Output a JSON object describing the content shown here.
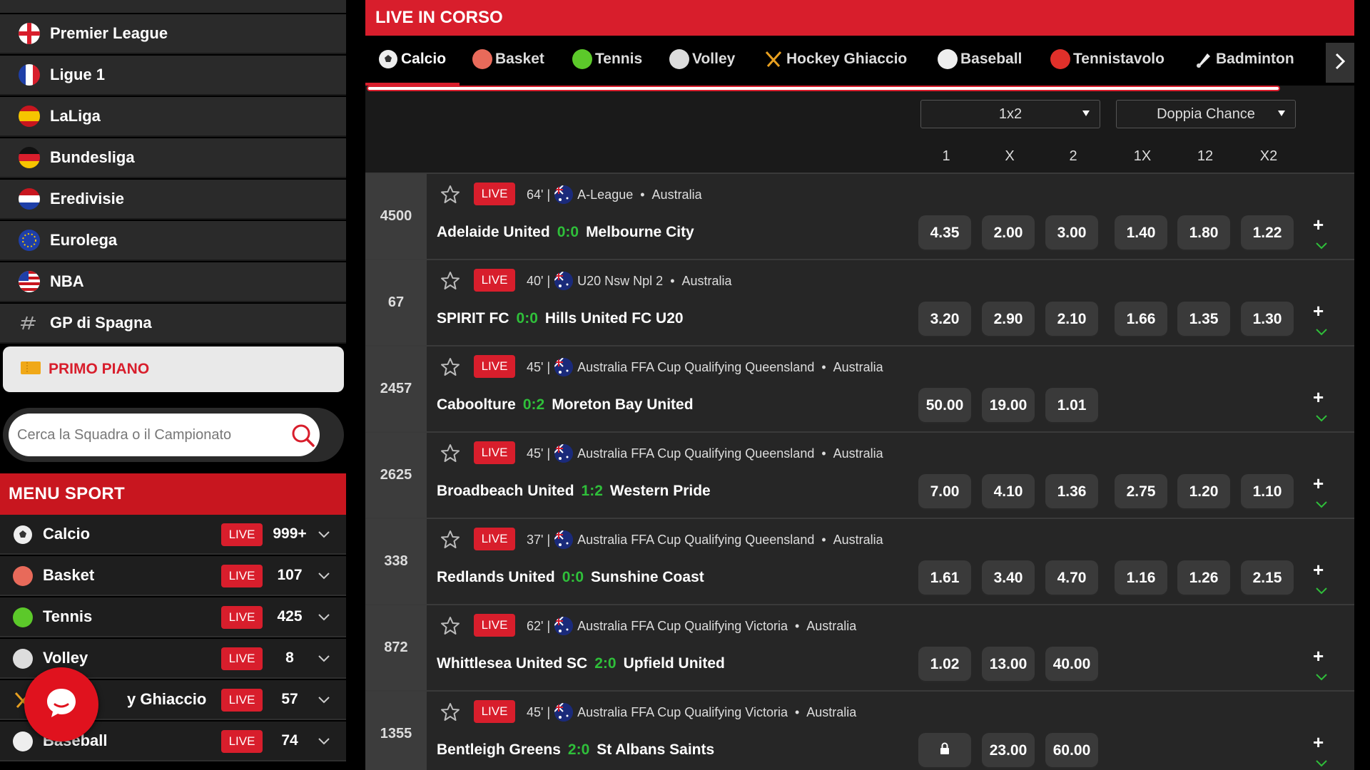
{
  "sidebar": {
    "leagues": [
      {
        "label": "Premier League",
        "flag": "england"
      },
      {
        "label": "Ligue 1",
        "flag": "france"
      },
      {
        "label": "LaLiga",
        "flag": "spain"
      },
      {
        "label": "Bundesliga",
        "flag": "germany"
      },
      {
        "label": "Eredivisie",
        "flag": "netherlands"
      },
      {
        "label": "Eurolega",
        "flag": "eu"
      },
      {
        "label": "NBA",
        "flag": "usa"
      },
      {
        "label": "GP di Spagna",
        "flag": "f1"
      }
    ],
    "primo_piano": "PRIMO PIANO",
    "search_placeholder": "Cerca la Squadra o il Campionato",
    "menu_title": "MENU SPORT",
    "live_label": "LIVE",
    "sports": [
      {
        "label": "Calcio",
        "count": "999+",
        "icon": "soccer-ball-icon"
      },
      {
        "label": "Basket",
        "count": "107",
        "icon": "basketball-icon"
      },
      {
        "label": "Tennis",
        "count": "425",
        "icon": "tennis-ball-icon"
      },
      {
        "label": "Volley",
        "count": "8",
        "icon": "volleyball-icon"
      },
      {
        "label": "y Ghiaccio",
        "count": "57",
        "icon": "hockey-icon"
      },
      {
        "label": "Baseball",
        "count": "74",
        "icon": "baseball-icon"
      }
    ]
  },
  "main": {
    "title": "LIVE IN CORSO",
    "tabs": [
      {
        "label": "Calcio",
        "icon": "soccer-ball-icon"
      },
      {
        "label": "Basket",
        "icon": "basketball-icon"
      },
      {
        "label": "Tennis",
        "icon": "tennis-ball-icon"
      },
      {
        "label": "Volley",
        "icon": "volleyball-icon"
      },
      {
        "label": "Hockey Ghiaccio",
        "icon": "hockey-icon"
      },
      {
        "label": "Baseball",
        "icon": "baseball-icon"
      },
      {
        "label": "Tennistavolo",
        "icon": "table-tennis-icon"
      },
      {
        "label": "Badminton",
        "icon": "badminton-icon"
      }
    ],
    "select_1": "1x2",
    "select_2": "Doppia Chance",
    "columns": [
      "1",
      "X",
      "2",
      "1X",
      "12",
      "X2"
    ],
    "live_label": "LIVE",
    "matches": [
      {
        "id": "4500",
        "minute": "64'",
        "competition": "A-League",
        "country": "Australia",
        "home": "Adelaide United",
        "score": "0:0",
        "away": "Melbourne City",
        "odds": [
          "4.35",
          "2.00",
          "3.00",
          "1.40",
          "1.80",
          "1.22"
        ]
      },
      {
        "id": "67",
        "minute": "40'",
        "competition": "U20 Nsw Npl 2",
        "country": "Australia",
        "home": "SPIRIT FC",
        "score": "0:0",
        "away": "Hills United FC U20",
        "odds": [
          "3.20",
          "2.90",
          "2.10",
          "1.66",
          "1.35",
          "1.30"
        ]
      },
      {
        "id": "2457",
        "minute": "45'",
        "competition": "Australia FFA Cup Qualifying Queensland",
        "country": "Australia",
        "home": "Caboolture",
        "score": "0:2",
        "away": "Moreton Bay United",
        "odds": [
          "50.00",
          "19.00",
          "1.01",
          "",
          "",
          ""
        ]
      },
      {
        "id": "2625",
        "minute": "45'",
        "competition": "Australia FFA Cup Qualifying Queensland",
        "country": "Australia",
        "home": "Broadbeach United",
        "score": "1:2",
        "away": "Western Pride",
        "odds": [
          "7.00",
          "4.10",
          "1.36",
          "2.75",
          "1.20",
          "1.10"
        ]
      },
      {
        "id": "338",
        "minute": "37'",
        "competition": "Australia FFA Cup Qualifying Queensland",
        "country": "Australia",
        "home": "Redlands United",
        "score": "0:0",
        "away": "Sunshine Coast",
        "odds": [
          "1.61",
          "3.40",
          "4.70",
          "1.16",
          "1.26",
          "2.15"
        ]
      },
      {
        "id": "872",
        "minute": "62'",
        "competition": "Australia FFA Cup Qualifying Victoria",
        "country": "Australia",
        "home": "Whittlesea United SC",
        "score": "2:0",
        "away": "Upfield United",
        "odds": [
          "1.02",
          "13.00",
          "40.00",
          "",
          "",
          ""
        ]
      },
      {
        "id": "1355",
        "minute": "45'",
        "competition": "Australia FFA Cup Qualifying Victoria",
        "country": "Australia",
        "home": "Bentleigh Greens",
        "score": "2:0",
        "away": "St Albans Saints",
        "odds": [
          "lock",
          "23.00",
          "60.00",
          "",
          "",
          ""
        ]
      }
    ]
  },
  "colors": {
    "accent": "#d81e2c",
    "score": "#2fbf3a",
    "primo_text": "#d81e2c"
  }
}
